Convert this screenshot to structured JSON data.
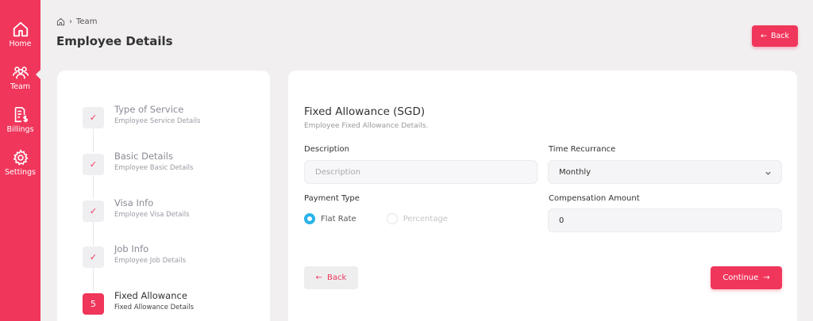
{
  "sidebar": {
    "items": [
      {
        "label": "Home",
        "icon": "home-icon"
      },
      {
        "label": "Team",
        "icon": "team-icon"
      },
      {
        "label": "Billings",
        "icon": "billings-icon"
      },
      {
        "label": "Settings",
        "icon": "gear-icon"
      }
    ],
    "active": "Team"
  },
  "header": {
    "breadcrumb": "Team",
    "title": "Employee Details",
    "back_label": "Back"
  },
  "steps": [
    {
      "title": "Type of Service",
      "subtitle": "Employee Service Details",
      "status": "done"
    },
    {
      "title": "Basic Details",
      "subtitle": "Employee Basic Details",
      "status": "done"
    },
    {
      "title": "Visa Info",
      "subtitle": "Employee Visa Details",
      "status": "done"
    },
    {
      "title": "Job Info",
      "subtitle": "Employee Job Details",
      "status": "done"
    },
    {
      "title": "Fixed Allowance",
      "subtitle": "Fixed Allowance Details",
      "status": "current",
      "number": "5"
    }
  ],
  "form": {
    "title": "Fixed Allowance (SGD)",
    "subtitle": "Employee Fixed Allowance Details.",
    "description_label": "Description",
    "description_placeholder": "Description",
    "recurrence_label": "Time Recurrance",
    "recurrence_value": "Monthly",
    "payment_type_label": "Payment Type",
    "payment_options": [
      {
        "label": "Flat Rate",
        "selected": true
      },
      {
        "label": "Percentage",
        "selected": false
      }
    ],
    "compensation_label": "Compensation Amount",
    "compensation_value": "0",
    "back_label": "Back",
    "continue_label": "Continue"
  },
  "colors": {
    "accent": "#f0365b",
    "radio_selected": "#29b3ea",
    "background": "#f1eff0"
  }
}
